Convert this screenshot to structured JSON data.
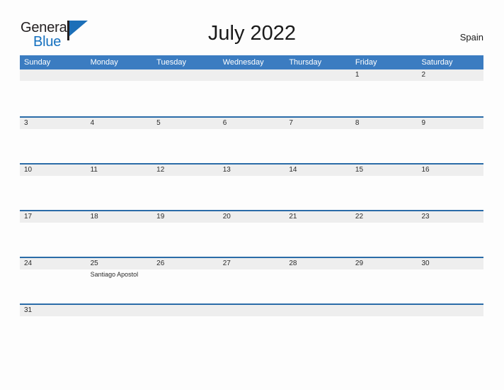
{
  "brand": {
    "name_part1": "General",
    "name_part2": "Blue",
    "flag_icon": "flag-icon",
    "accent_color": "#1470bf"
  },
  "header": {
    "title": "July 2022",
    "region": "Spain"
  },
  "calendar": {
    "header_bg": "#3b7cc1",
    "row_border_color": "#2b6ca8",
    "number_band_color": "#eeeeee",
    "day_headers": [
      "Sunday",
      "Monday",
      "Tuesday",
      "Wednesday",
      "Thursday",
      "Friday",
      "Saturday"
    ],
    "weeks": [
      [
        {
          "num": ""
        },
        {
          "num": ""
        },
        {
          "num": ""
        },
        {
          "num": ""
        },
        {
          "num": ""
        },
        {
          "num": "1"
        },
        {
          "num": "2"
        }
      ],
      [
        {
          "num": "3"
        },
        {
          "num": "4"
        },
        {
          "num": "5"
        },
        {
          "num": "6"
        },
        {
          "num": "7"
        },
        {
          "num": "8"
        },
        {
          "num": "9"
        }
      ],
      [
        {
          "num": "10"
        },
        {
          "num": "11"
        },
        {
          "num": "12"
        },
        {
          "num": "13"
        },
        {
          "num": "14"
        },
        {
          "num": "15"
        },
        {
          "num": "16"
        }
      ],
      [
        {
          "num": "17"
        },
        {
          "num": "18"
        },
        {
          "num": "19"
        },
        {
          "num": "20"
        },
        {
          "num": "21"
        },
        {
          "num": "22"
        },
        {
          "num": "23"
        }
      ],
      [
        {
          "num": "24"
        },
        {
          "num": "25",
          "event": "Santiago Apostol"
        },
        {
          "num": "26"
        },
        {
          "num": "27"
        },
        {
          "num": "28"
        },
        {
          "num": "29"
        },
        {
          "num": "30"
        }
      ],
      [
        {
          "num": "31"
        },
        {
          "num": ""
        },
        {
          "num": ""
        },
        {
          "num": ""
        },
        {
          "num": ""
        },
        {
          "num": ""
        },
        {
          "num": ""
        }
      ]
    ]
  }
}
